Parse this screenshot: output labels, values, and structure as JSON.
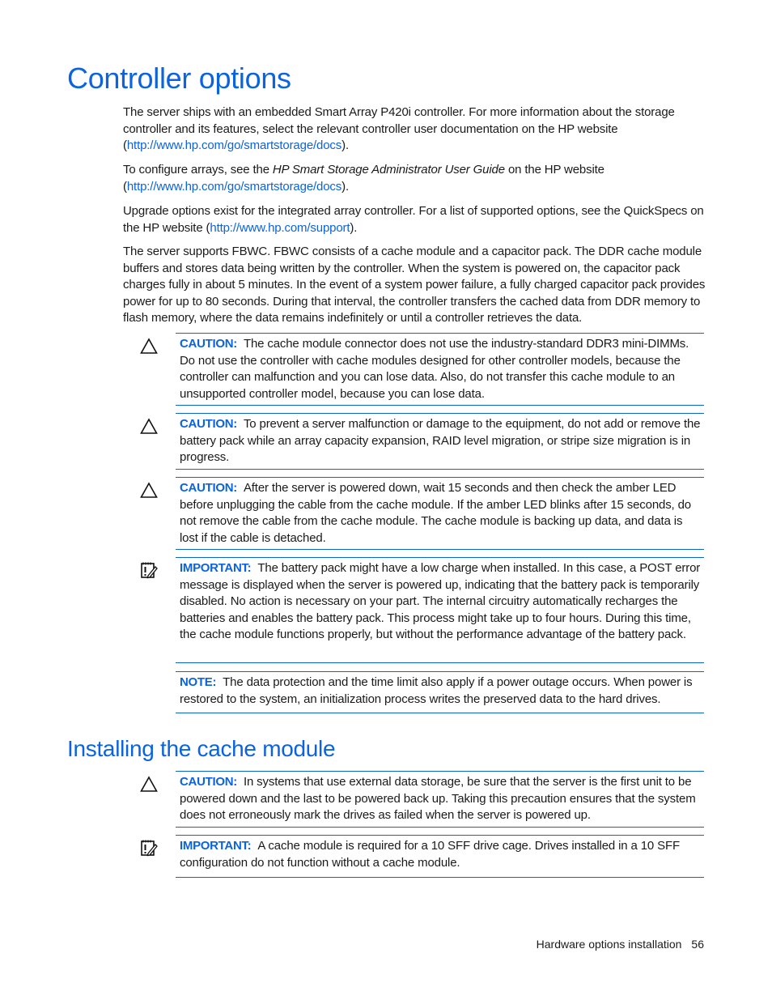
{
  "section1": {
    "title": "Controller options",
    "paragraphs": {
      "p1": {
        "text": "The server ships with an embedded Smart Array P420i controller. For more information about the storage controller and its features, select the relevant controller user documentation on the HP website (",
        "link": "http://www.hp.com/go/smartstorage/docs",
        "after": ")."
      },
      "p2": {
        "before": "To configure arrays, see the ",
        "italic": "HP Smart Storage Administrator User Guide",
        "text": " on the HP website (",
        "link": "http://www.hp.com/go/smartstorage/docs",
        "after": ")."
      },
      "p3": {
        "text": "Upgrade options exist for the integrated array controller. For a list of supported options, see the QuickSpecs on the HP website (",
        "link": "http://www.hp.com/support",
        "after": ")."
      },
      "p4": {
        "text": "The server supports FBWC. FBWC consists of a cache module and a capacitor pack. The DDR cache module buffers and stores data being written by the controller. When the system is powered on, the capacitor pack charges fully in about 5 minutes. In the event of a system power failure, a fully charged capacitor pack provides power for up to 80 seconds. During that interval, the controller transfers the cached data from DDR memory to flash memory, where the data remains indefinitely or until a controller retrieves the data."
      }
    },
    "notices": [
      {
        "type": "caution",
        "icon": "caution-triangle-icon",
        "label": "CAUTION:",
        "text": "The cache module connector does not use the industry-standard DDR3 mini-DIMMs. Do not use the controller with cache modules designed for other controller models, because the controller can malfunction and you can lose data. Also, do not transfer this cache module to an unsupported controller model, because you can lose data."
      },
      {
        "type": "caution",
        "icon": "caution-triangle-icon",
        "label": "CAUTION:",
        "text": "To prevent a server malfunction or damage to the equipment, do not add or remove the battery pack while an array capacity expansion, RAID level migration, or stripe size migration is in progress."
      },
      {
        "type": "caution",
        "icon": "caution-triangle-icon",
        "label": "CAUTION:",
        "text": "After the server is powered down, wait 15 seconds and then check the amber LED before unplugging the cable from the cache module. If the amber LED blinks after 15 seconds, do not remove the cable from the cache module. The cache module is backing up data, and data is lost if the cable is detached."
      },
      {
        "type": "important",
        "icon": "important-notepad-icon",
        "label": "IMPORTANT:",
        "text": "The battery pack might have a low charge when installed. In this case, a POST error message is displayed when the server is powered up, indicating that the battery pack is temporarily disabled. No action is necessary on your part. The internal circuitry automatically recharges the batteries and enables the battery pack. This process might take up to four hours. During this time, the cache module functions properly, but without the performance advantage of the battery pack."
      },
      {
        "type": "note",
        "icon": "",
        "label": "NOTE:",
        "text": "The data protection and the time limit also apply if a power outage occurs. When power is restored to the system, an initialization process writes the preserved data to the hard drives."
      }
    ]
  },
  "section2": {
    "title": "Installing the cache module",
    "notices": [
      {
        "type": "caution",
        "icon": "caution-triangle-icon",
        "label": "CAUTION:",
        "text": "In systems that use external data storage, be sure that the server is the first unit to be powered down and the last to be powered back up. Taking this precaution ensures that the system does not erroneously mark the drives as failed when the server is powered up."
      },
      {
        "type": "important",
        "icon": "important-notepad-icon",
        "label": "IMPORTANT:",
        "text": "A cache module is required for a 10 SFF drive cage. Drives installed in a 10 SFF configuration do not function without a cache module."
      }
    ]
  },
  "footer": {
    "section_name": "Hardware options installation",
    "page_number": "56"
  },
  "colors": {
    "accent": "#0b63dd",
    "text": "#1a1a1a"
  }
}
